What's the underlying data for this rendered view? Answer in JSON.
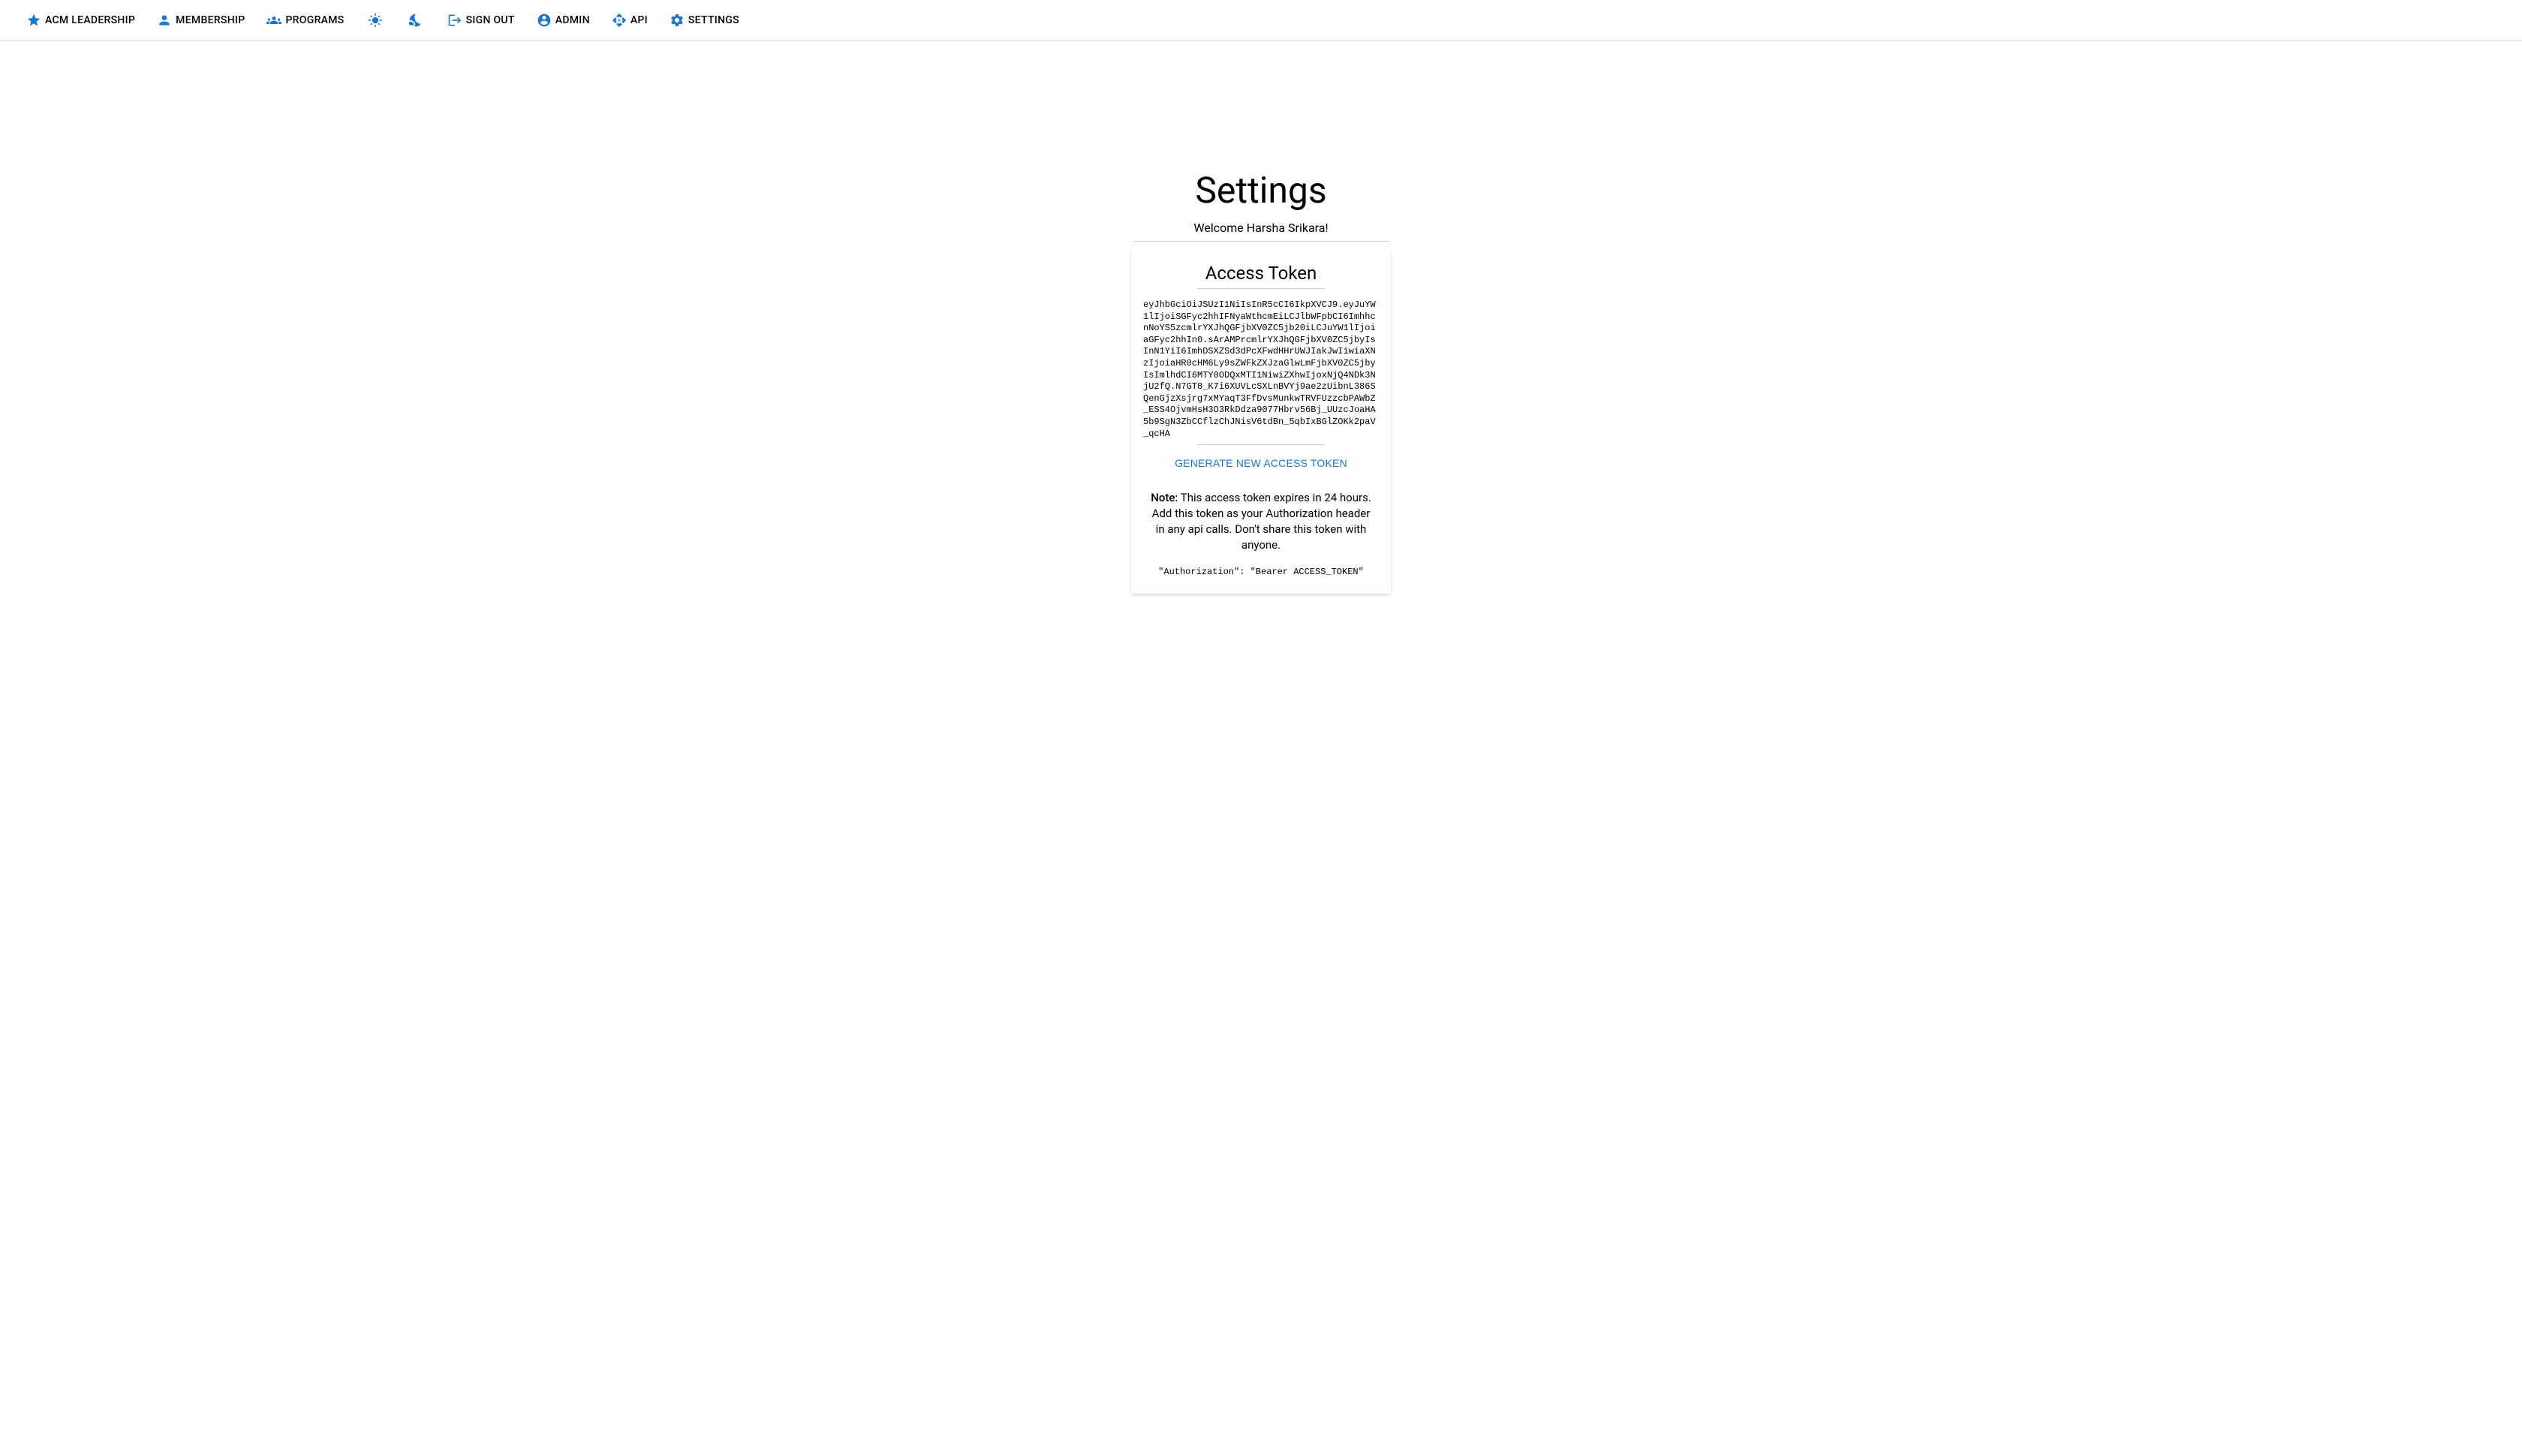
{
  "nav": {
    "leadership": "ACM LEADERSHIP",
    "membership": "MEMBERSHIP",
    "programs": "PROGRAMS",
    "signout": "SIGN OUT",
    "admin": "ADMIN",
    "api": "API",
    "settings": "SETTINGS"
  },
  "page": {
    "title": "Settings",
    "welcome": "Welcome Harsha Srikara!"
  },
  "card": {
    "heading": "Access Token",
    "token": "eyJhbGciOiJSUzI1NiIsInR5cCI6IkpXVCJ9.eyJuYW1lIjoiSGFyc2hhIFNyaWthcmEiLCJlbWFpbCI6ImhhcnNoYS5zcmlrYXJhQGFjbXV0ZC5jb20iLCJuYW1lIjoiaGFyc2hhIn0.sArAMPrcmlrYXJhQGFjbXV0ZC5jbyIsInN1YiI6ImhDSXZSd3dPcXFwdHHrUWJIakJwIiwiaXNzIjoiaHR0cHM6Ly9sZWFkZXJzaGlwLmFjbXV0ZC5jbyIsImlhdCI6MTY0ODQxMTI1NiwiZXhwIjoxNjQ4NDk3NjU2fQ.N7GT8_K7i6XUVLcSXLnBVYj9ae2zUibnL386SQenGjzXsjrg7xMYaqT3FfDvsMunkwTRVFUzzcbPAWbZ_ESS4OjvmHsH3O3RkDdza9077Hbrv56Bj_UUzcJoaHA5b9SgN3ZbCCflzChJNisV6tdBn_5qbIxBGlZOKk2paV_qcHA",
    "generate_label": "GENERATE NEW ACCESS TOKEN",
    "note_label": "Note:",
    "note_body": " This access token expires in 24 hours. Add this token as your Authorization header in any api calls. Don't share this token with anyone.",
    "auth_example": "\"Authorization\": \"Bearer ACCESS_TOKEN\""
  }
}
